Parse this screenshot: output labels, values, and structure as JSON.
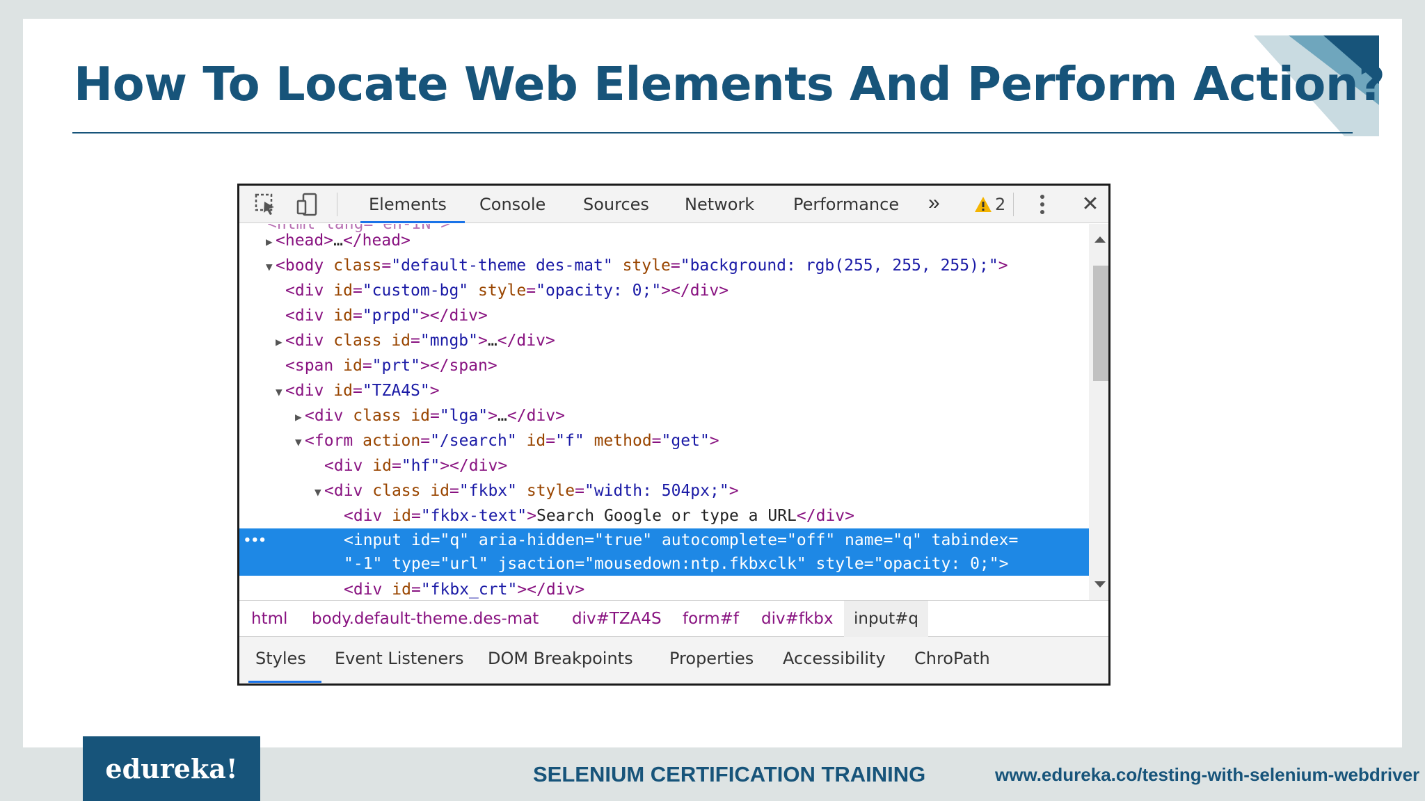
{
  "slide": {
    "title": "How To Locate Web Elements And Perform Action?",
    "footer_logo": "edureka!",
    "footer_course": "SELENIUM CERTIFICATION TRAINING",
    "footer_url": "www.edureka.co/testing-with-selenium-webdriver"
  },
  "devtools": {
    "tabs": [
      "Elements",
      "Console",
      "Sources",
      "Network",
      "Performance"
    ],
    "more_tabs": "»",
    "warning_count": "2",
    "close": "✕",
    "lines": [
      {
        "pre": "",
        "t": "<head>",
        "mid": "…",
        "end": "</head>"
      },
      {
        "body_class": "default-theme des-mat",
        "body_style": "background: rgb(255, 255, 255);"
      },
      {
        "id": "custom-bg",
        "style": "opacity: 0;"
      },
      {
        "id": "prpd"
      },
      {
        "class_id": "mngb"
      },
      {
        "span_id": "prt"
      },
      {
        "id": "TZA4S"
      },
      {
        "class_id": "lga"
      },
      {
        "action": "/search",
        "id": "f",
        "method": "get"
      },
      {
        "id": "hf"
      },
      {
        "class_id": "fkbx",
        "style": "width: 504px;"
      },
      {
        "id": "fkbx-text",
        "text": "Search Google or type a URL"
      },
      {
        "line1": "<input id=\"q\" aria-hidden=\"true\" autocomplete=\"off\" name=\"q\" tabindex=",
        "line2": "\"-1\" type=\"url\" jsaction=\"mousedown:ntp.fkbxclk\" style=\"opacity: 0;\">"
      },
      {
        "id": "fkbx_crt"
      }
    ],
    "breadcrumb": [
      "html",
      "body.default-theme.des-mat",
      "div#TZA4S",
      "form#f",
      "div#fkbx",
      "input#q"
    ],
    "bottom_tabs": [
      "Styles",
      "Event Listeners",
      "DOM Breakpoints",
      "Properties",
      "Accessibility",
      "ChroPath"
    ]
  },
  "colors": {
    "title": "#17547a",
    "selection": "#1e88e5",
    "tag": "#881280",
    "attr": "#994500",
    "value": "#1a1aa6"
  }
}
